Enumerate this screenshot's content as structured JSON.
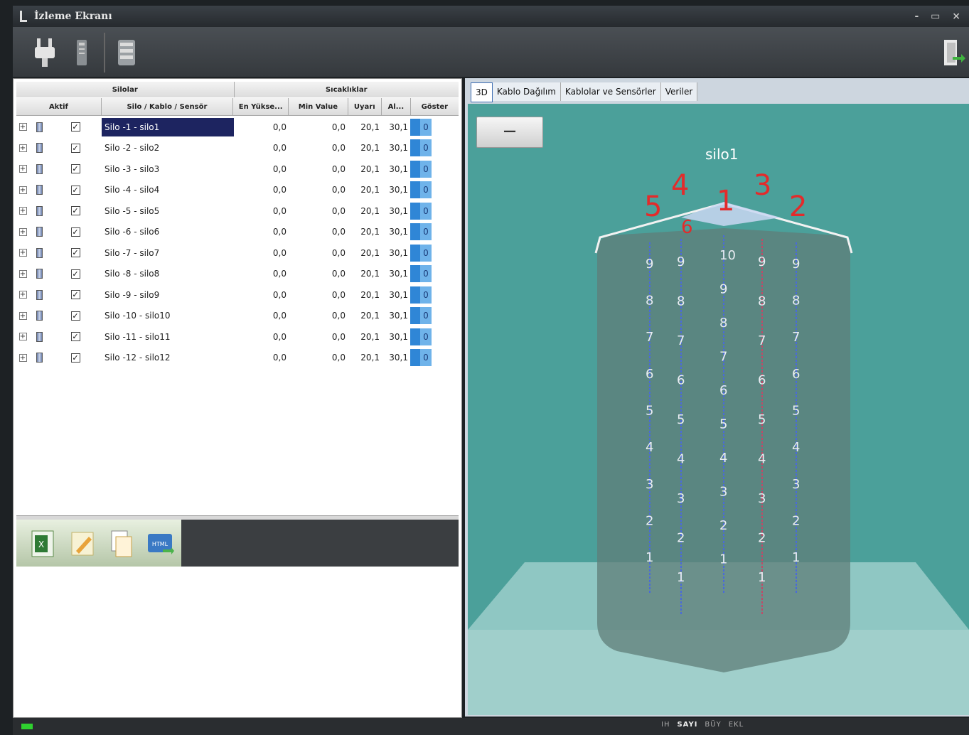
{
  "window": {
    "title": "İzleme Ekranı",
    "controls": "- ▭ ×"
  },
  "grid": {
    "group_silos": "Silolar",
    "group_temps": "Sıcaklıklar",
    "col_aktif": "Aktif",
    "col_name": "Silo / Kablo / Sensör",
    "col_max": "En Yükse...",
    "col_min": "Min Value",
    "col_uyari": "Uyarı",
    "col_alarm": "Al...",
    "col_goster": "Göster",
    "rows": [
      {
        "name": "Silo -1 - silo1",
        "max": "0,0",
        "min": "0,0",
        "uyari": "20,1",
        "alarm": "30,1",
        "goster": "0"
      },
      {
        "name": "Silo -2 - silo2",
        "max": "0,0",
        "min": "0,0",
        "uyari": "20,1",
        "alarm": "30,1",
        "goster": "0"
      },
      {
        "name": "Silo -3 - silo3",
        "max": "0,0",
        "min": "0,0",
        "uyari": "20,1",
        "alarm": "30,1",
        "goster": "0"
      },
      {
        "name": "Silo -4 - silo4",
        "max": "0,0",
        "min": "0,0",
        "uyari": "20,1",
        "alarm": "30,1",
        "goster": "0"
      },
      {
        "name": "Silo -5 - silo5",
        "max": "0,0",
        "min": "0,0",
        "uyari": "20,1",
        "alarm": "30,1",
        "goster": "0"
      },
      {
        "name": "Silo -6 - silo6",
        "max": "0,0",
        "min": "0,0",
        "uyari": "20,1",
        "alarm": "30,1",
        "goster": "0"
      },
      {
        "name": "Silo -7 - silo7",
        "max": "0,0",
        "min": "0,0",
        "uyari": "20,1",
        "alarm": "30,1",
        "goster": "0"
      },
      {
        "name": "Silo -8 - silo8",
        "max": "0,0",
        "min": "0,0",
        "uyari": "20,1",
        "alarm": "30,1",
        "goster": "0"
      },
      {
        "name": "Silo -9 - silo9",
        "max": "0,0",
        "min": "0,0",
        "uyari": "20,1",
        "alarm": "30,1",
        "goster": "0"
      },
      {
        "name": "Silo -10 - silo10",
        "max": "0,0",
        "min": "0,0",
        "uyari": "20,1",
        "alarm": "30,1",
        "goster": "0"
      },
      {
        "name": "Silo -11 - silo11",
        "max": "0,0",
        "min": "0,0",
        "uyari": "20,1",
        "alarm": "30,1",
        "goster": "0"
      },
      {
        "name": "Silo -12 - silo12",
        "max": "0,0",
        "min": "0,0",
        "uyari": "20,1",
        "alarm": "30,1",
        "goster": "0"
      }
    ]
  },
  "tabs": [
    "3D",
    "Kablo Dağılım",
    "Kablolar ve Sensörler",
    "Veriler"
  ],
  "scene": {
    "silo_label": "silo1",
    "collapse_button": "—",
    "cable_labels": [
      "5",
      "4",
      "1",
      "3",
      "2",
      "6"
    ],
    "sensor_labels_cable1": [
      "9",
      "8",
      "7",
      "6",
      "5",
      "4",
      "3",
      "2",
      "1"
    ],
    "sensor_labels_cable2": [
      "9",
      "8",
      "7",
      "6",
      "5",
      "4",
      "3",
      "2",
      "1"
    ],
    "sensor_labels_cable3": [
      "10",
      "9",
      "8",
      "7",
      "6",
      "5",
      "4",
      "3",
      "2",
      "1"
    ],
    "sensor_labels_cable4": [
      "9",
      "8",
      "7",
      "6",
      "5",
      "4",
      "3",
      "2",
      "1"
    ],
    "sensor_labels_cable5": [
      "9",
      "8",
      "7",
      "6",
      "5",
      "4",
      "3",
      "2",
      "1"
    ]
  },
  "status": {
    "items": [
      "IH",
      "SAYI",
      "BÜY",
      "EKL"
    ]
  },
  "colors": {
    "scene_bg": "#4ba09a",
    "selected_row": "#1d2460",
    "cable_label": "#e32b2b",
    "show_cell": "#2f86d6"
  }
}
